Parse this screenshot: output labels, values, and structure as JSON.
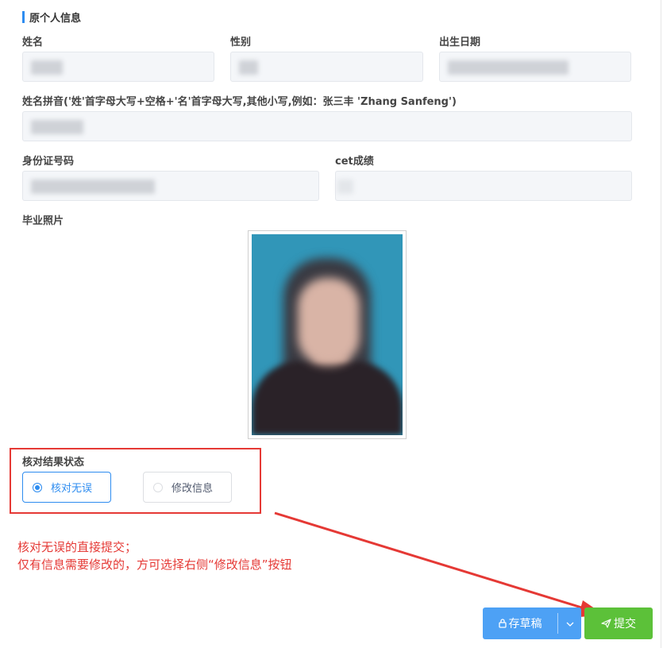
{
  "section": {
    "title": "原个人信息"
  },
  "fields": {
    "name_label": "姓名",
    "gender_label": "性别",
    "birth_label": "出生日期",
    "pinyin_label": "姓名拼音('姓'首字母大写+空格+'名'首字母大写,其他小写,例如：张三丰 'Zhang Sanfeng')",
    "id_label": "身份证号码",
    "cet_label": "cet成绩",
    "photo_label": "毕业照片"
  },
  "verify": {
    "label": "核对结果状态",
    "options": [
      "核对无误",
      "修改信息"
    ],
    "selected": "核对无误"
  },
  "annotation": {
    "line1": "核对无误的直接提交；",
    "line2": "仅有信息需要修改的，方可选择右侧“修改信息”按钮"
  },
  "buttons": {
    "draft": "存草稿",
    "submit": "提交"
  },
  "colors": {
    "accent": "#2d8cf0",
    "annotation_red": "#e53935",
    "draft_blue": "#4da1f5",
    "submit_green": "#5cc139"
  }
}
